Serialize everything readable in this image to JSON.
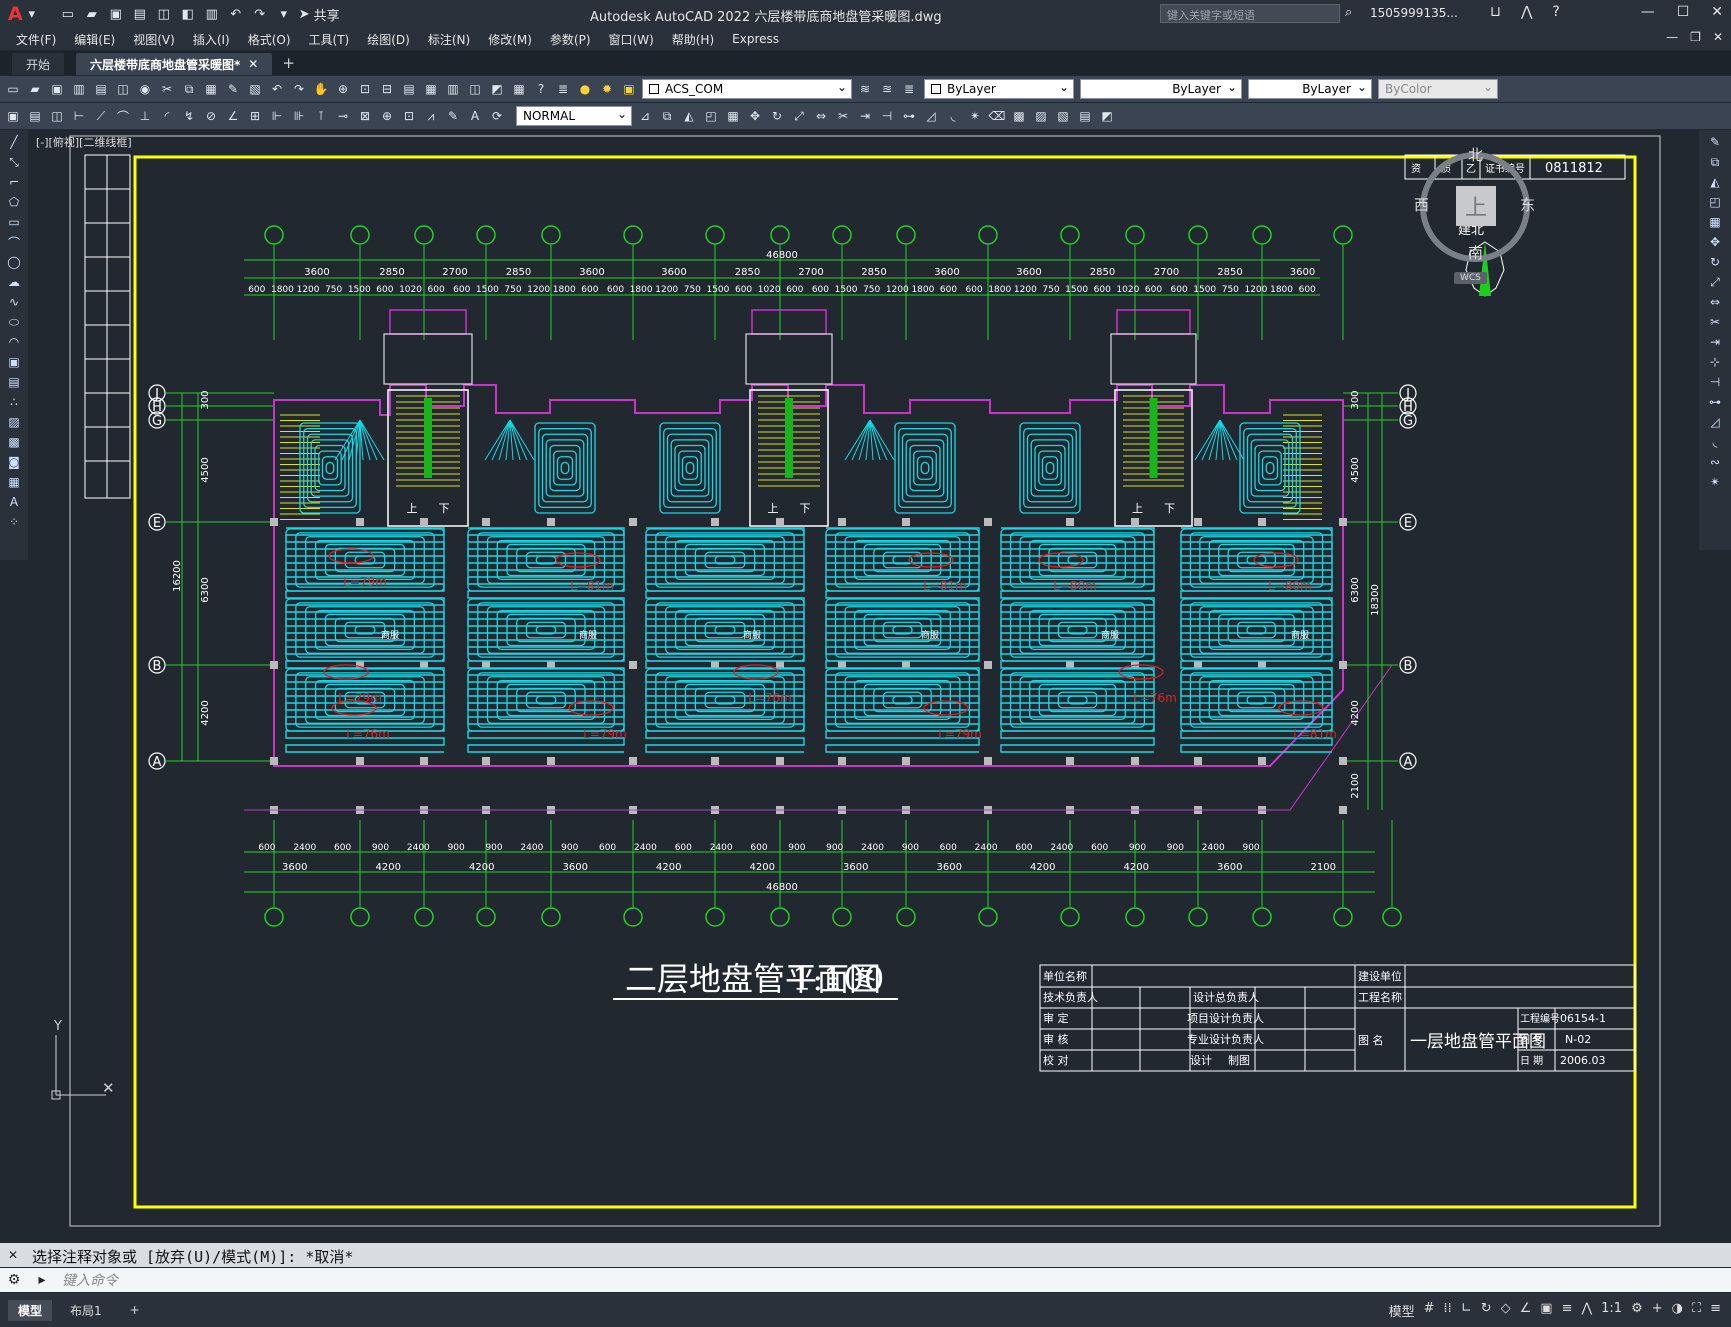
{
  "app": {
    "logo": "A",
    "window_title": "Autodesk AutoCAD 2022    六层楼带底商地盘管采暖图.dwg",
    "share": "共享",
    "search_placeholder": "键入关键字或短语",
    "user": "1505999135..."
  },
  "menu": [
    "文件(F)",
    "编辑(E)",
    "视图(V)",
    "插入(I)",
    "格式(O)",
    "工具(T)",
    "绘图(D)",
    "标注(N)",
    "修改(M)",
    "参数(P)",
    "窗口(W)",
    "帮助(H)",
    "Express"
  ],
  "tabs": {
    "start": "开始",
    "drawing": "六层楼带底商地盘管采暖图*"
  },
  "toolbar": {
    "ucs": "ACS_COM",
    "layer": "ByLayer",
    "linetype": "ByLayer",
    "lineweight": "ByLayer",
    "color": "ByColor",
    "dimstyle": "NORMAL"
  },
  "viewport_label": "[-][俯视][二维线框]",
  "drawing": {
    "title": "二层地盘管平面图",
    "scale": "1:100",
    "total_dim": "46800",
    "top_dims": [
      "3600",
      "2850",
      "2700",
      "2850",
      "3600",
      "3600",
      "2850",
      "2700",
      "2850",
      "3600",
      "3600",
      "2850",
      "2700",
      "2850",
      "3600"
    ],
    "top_sub": [
      "600",
      "1800",
      "1200",
      "750",
      "1500",
      "600",
      "1020",
      "600",
      "600",
      "1500",
      "750",
      "1200",
      "1800",
      "600",
      "600",
      "1800",
      "1200",
      "750",
      "1500",
      "600",
      "1020",
      "600",
      "600",
      "1500",
      "750",
      "1200",
      "1800",
      "600",
      "600",
      "1800",
      "1200",
      "750",
      "1500",
      "600",
      "1020",
      "600",
      "600",
      "1500",
      "750",
      "1200",
      "1800",
      "600"
    ],
    "bottom_dims": [
      "600",
      "2400",
      "600",
      "900",
      "2400",
      "900",
      "900",
      "2400",
      "900",
      "600",
      "2400",
      "600",
      "2400",
      "600",
      "900",
      "900",
      "2400",
      "900",
      "600",
      "2400",
      "600",
      "2400",
      "600",
      "900",
      "900",
      "2400",
      "900"
    ],
    "bottom_sub": [
      "3600",
      "4200",
      "4200",
      "3600",
      "4200",
      "4200",
      "3600",
      "3600",
      "4200",
      "4200",
      "3600",
      "2100"
    ],
    "axis_letters_left": [
      "J",
      "H",
      "G",
      "E",
      "B",
      "A"
    ],
    "axis_letters_right": [
      "J",
      "H",
      "G",
      "E",
      "B",
      "A"
    ],
    "left_dims": [
      "300",
      "4500",
      "6300",
      "4200",
      "16200"
    ],
    "right_dims": [
      "300",
      "4500",
      "6300",
      "4200",
      "2100",
      "18300"
    ],
    "loop_labels": [
      "L=79m",
      "L=79m",
      "L=81m",
      "L=81m",
      "L=80m",
      "L=80m",
      "L=76m",
      "L=76m",
      "L=76m",
      "L=79m",
      "L=79m",
      "L=81m"
    ],
    "room_label": "商服",
    "stair_up": "上",
    "stair_down": "下",
    "cert_label": "证书编号",
    "cert_no": "0811812",
    "cert_grade": "乙",
    "cert_a": "资",
    "cert_b": "质"
  },
  "title_block": {
    "unit_name": "单位名称",
    "tech": "技术负责人",
    "review": "审  定",
    "check": "审  核",
    "proof": "校  对",
    "design_head": "设计总负责人",
    "project_head": "项目设计负责人",
    "spec_head": "专业设计负责人",
    "design": "设计",
    "draw": "制图",
    "build_unit": "建设单位",
    "project_name": "工程名称",
    "drawing_name_label": "图  名",
    "drawing_name": "一层地盘管平面图",
    "proj_no_label": "工程编号",
    "proj_no": "06154-1",
    "fig_no_label": "图  号",
    "fig_no": "N-02",
    "date_label": "日  期",
    "date": "2006.03"
  },
  "viewcube": {
    "north": "北",
    "south": "南",
    "east": "东",
    "west": "西",
    "top": "上",
    "wcs": "WCS"
  },
  "compass_label": "建北",
  "command": {
    "history": "选择注释对象或 [放弃(U)/模式(M)]: *取消*",
    "placeholder": "键入命令"
  },
  "status": {
    "model_tab": "模型",
    "layout1": "布局1",
    "model_btn": "模型",
    "scale": "1:1"
  },
  "colors": {
    "bg": "#212830",
    "frame": "#ffff00",
    "pipe": "#19d7e6",
    "grid": "#1fd41f",
    "wall": "#cc33cc",
    "label": "#e0201f"
  }
}
